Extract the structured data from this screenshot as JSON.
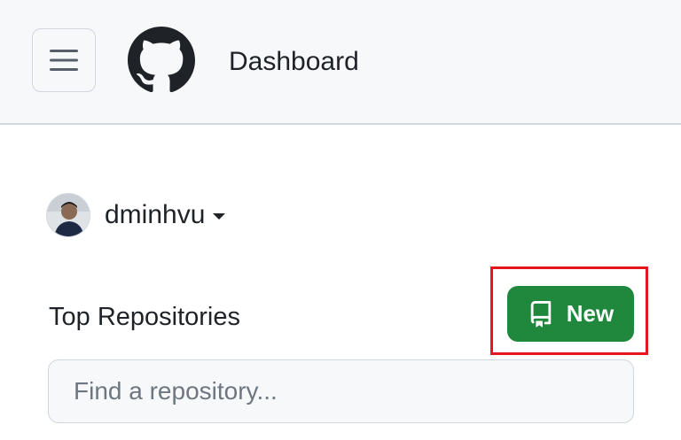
{
  "header": {
    "menu_icon": "hamburger-icon",
    "logo_icon": "github-logo-icon",
    "title": "Dashboard"
  },
  "user": {
    "name": "dminhvu",
    "avatar_icon": "avatar",
    "dropdown_icon": "caret-down-icon"
  },
  "repositories": {
    "title": "Top Repositories",
    "new_button_label": "New",
    "new_button_icon": "repo-icon",
    "search_placeholder": "Find a repository..."
  },
  "colors": {
    "primary_button": "#1f883d",
    "header_background": "#f6f8fa",
    "highlight": "#e5161d"
  }
}
